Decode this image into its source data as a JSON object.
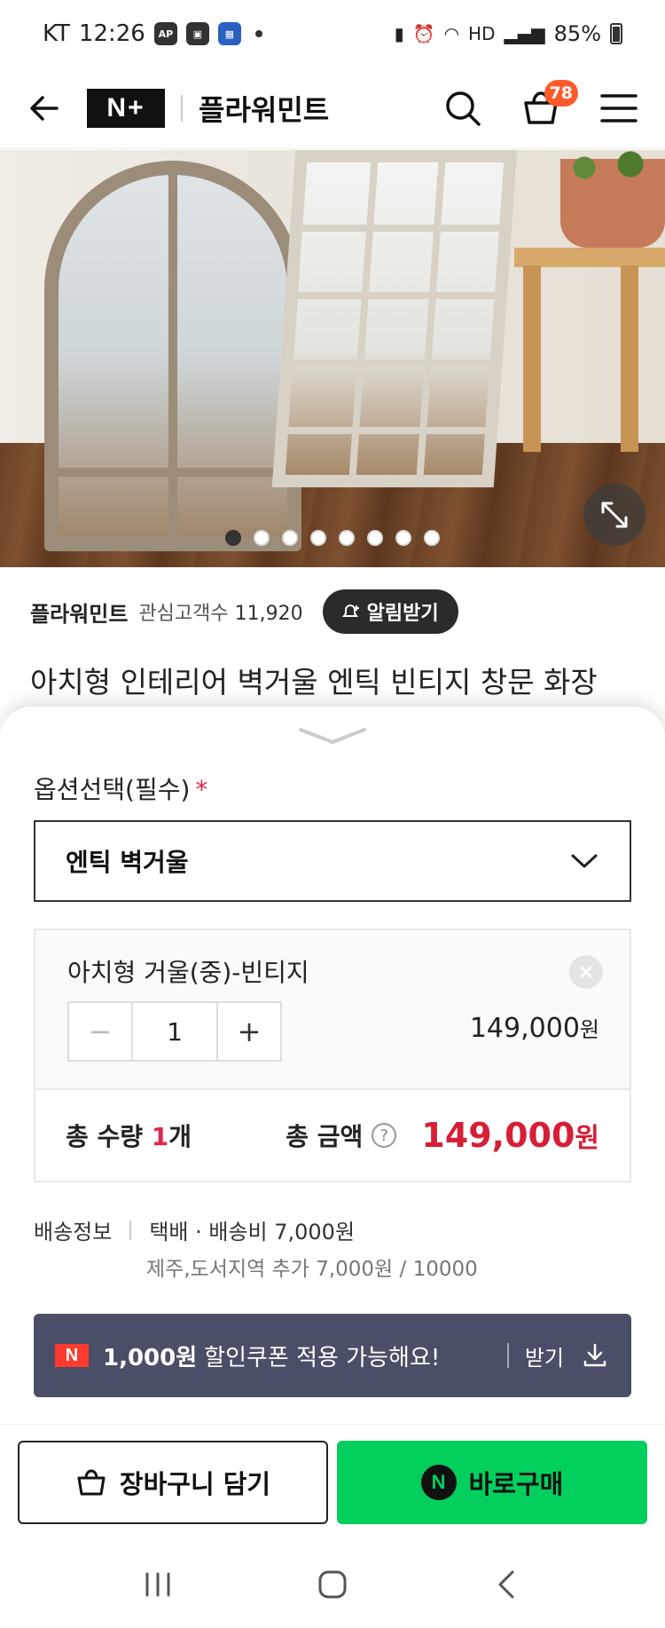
{
  "status": {
    "carrier": "KT",
    "time": "12:26",
    "battery": "85%"
  },
  "header": {
    "logo": "N+",
    "store_name": "플라워민트",
    "cart_count": "78"
  },
  "hero": {
    "slide_count": 8,
    "active_slide": 1
  },
  "store_info": {
    "name": "플라워민트",
    "interest_label": "관심고객수",
    "interest_count": "11,920",
    "alarm_label": "알림받기"
  },
  "product": {
    "title": "아치형 인테리어 벽거울 엔틱 빈티지 창문 화장"
  },
  "option": {
    "label": "옵션선택(필수)",
    "required_mark": "*",
    "selected": "엔틱 벽거울"
  },
  "item": {
    "name": "아치형 거울(중)-빈티지",
    "quantity": "1",
    "minus": "−",
    "plus": "+",
    "price": "149,000",
    "price_unit": "원"
  },
  "totals": {
    "qty_label": "총 수량 ",
    "qty_value": "1",
    "qty_unit": "개",
    "amount_label": "총 금액",
    "help": "?",
    "amount": "149,000",
    "amount_unit": "원"
  },
  "shipping": {
    "label": "배송정보",
    "method": "택배 · 배송비 7,000원",
    "extra": "제주,도서지역 추가 7,000원 / 10000"
  },
  "coupon": {
    "logo": "N",
    "amount": "1,000원",
    "message": "할인쿠폰 적용 가능해요!",
    "get_label": "받기"
  },
  "buttons": {
    "cart": "장바구니 담기",
    "buy": "바로구매",
    "buy_mark": "N"
  },
  "colors": {
    "accent_red": "#d61f36",
    "naver_green": "#03cf5d",
    "coupon_bg": "#4a4e66",
    "badge": "#ff5a2a"
  }
}
